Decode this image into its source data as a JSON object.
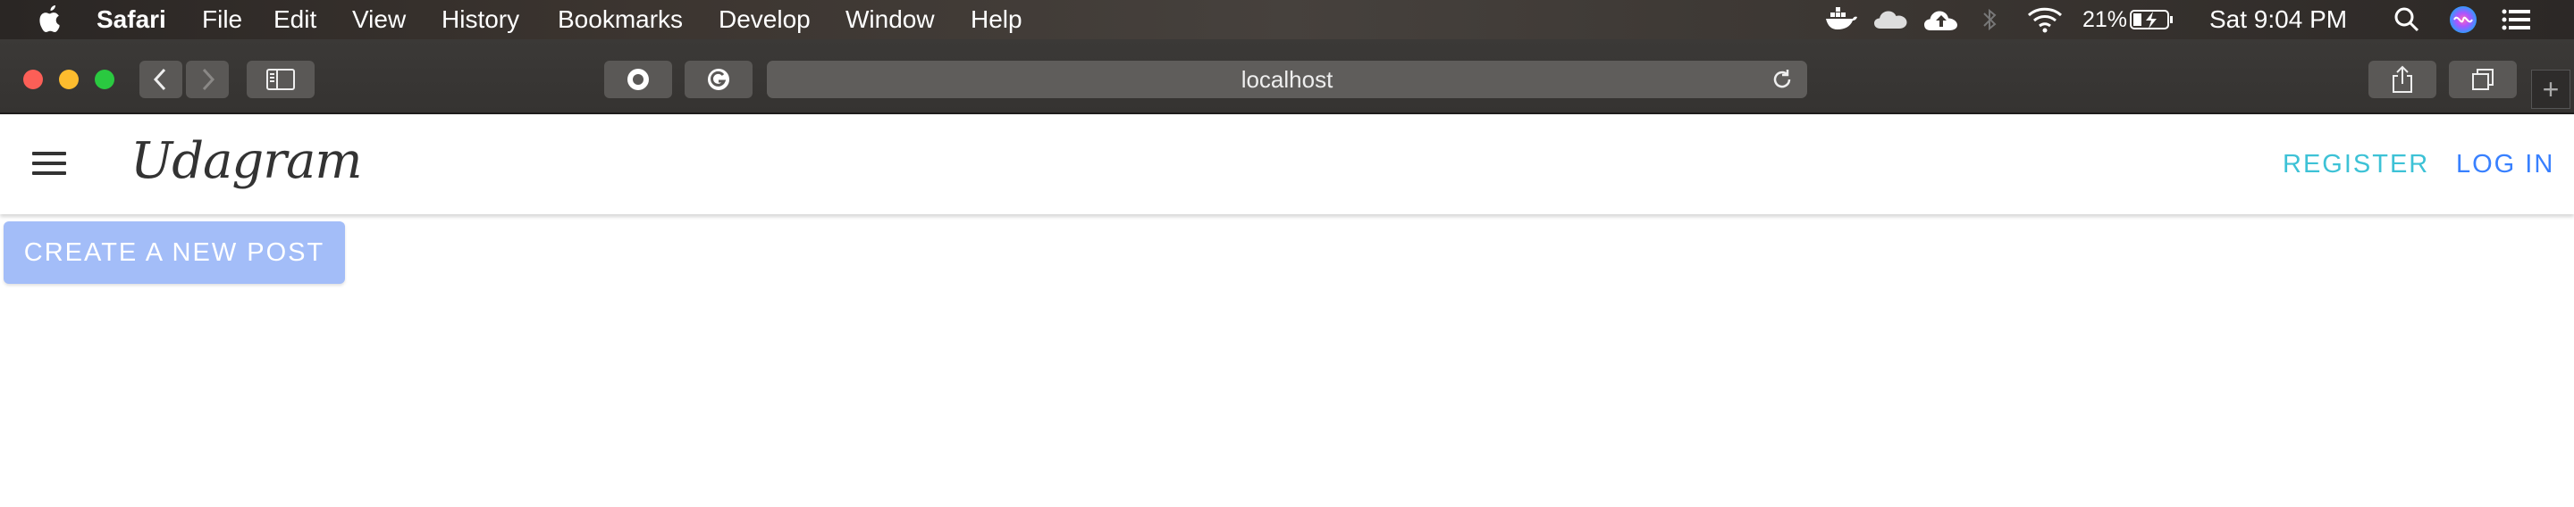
{
  "menubar": {
    "app_name": "Safari",
    "items": [
      "File",
      "Edit",
      "View",
      "History",
      "Bookmarks",
      "Develop",
      "Window",
      "Help"
    ],
    "battery_percent": "21%",
    "clock": "Sat 9:04 PM"
  },
  "browser": {
    "address": "localhost"
  },
  "app": {
    "brand": "Udagram",
    "nav": {
      "register": "REGISTER",
      "login": "LOG IN"
    },
    "create_button": "CREATE A NEW POST"
  },
  "colors": {
    "register": "#3dc2d6",
    "login": "#3880ff",
    "create_button_bg": "#a3bdf8"
  }
}
